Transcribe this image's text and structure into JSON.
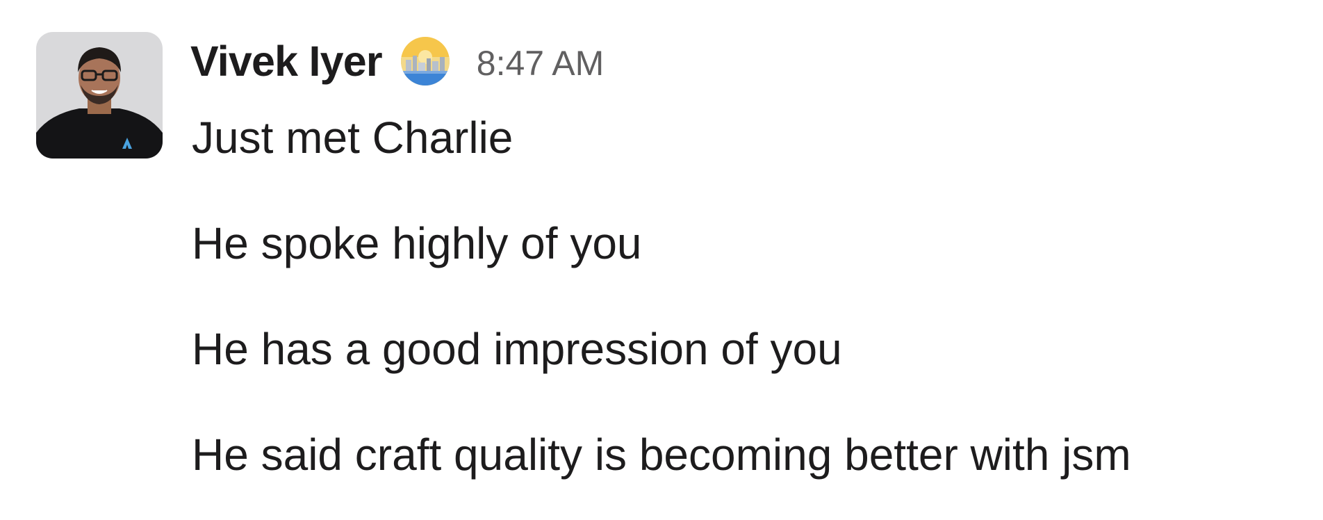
{
  "message": {
    "sender": {
      "name": "Vivek Iyer",
      "avatar_icon": "user-avatar-photo",
      "status_emoji_icon": "cityscape-sunrise-emoji-icon"
    },
    "timestamp": "8:47 AM",
    "lines": [
      "Just met Charlie",
      "He spoke highly of you",
      "He has a good impression of you",
      "He said craft quality is becoming better with jsm"
    ]
  },
  "colors": {
    "text_primary": "#1d1c1d",
    "text_secondary": "#616061",
    "background": "#ffffff"
  }
}
